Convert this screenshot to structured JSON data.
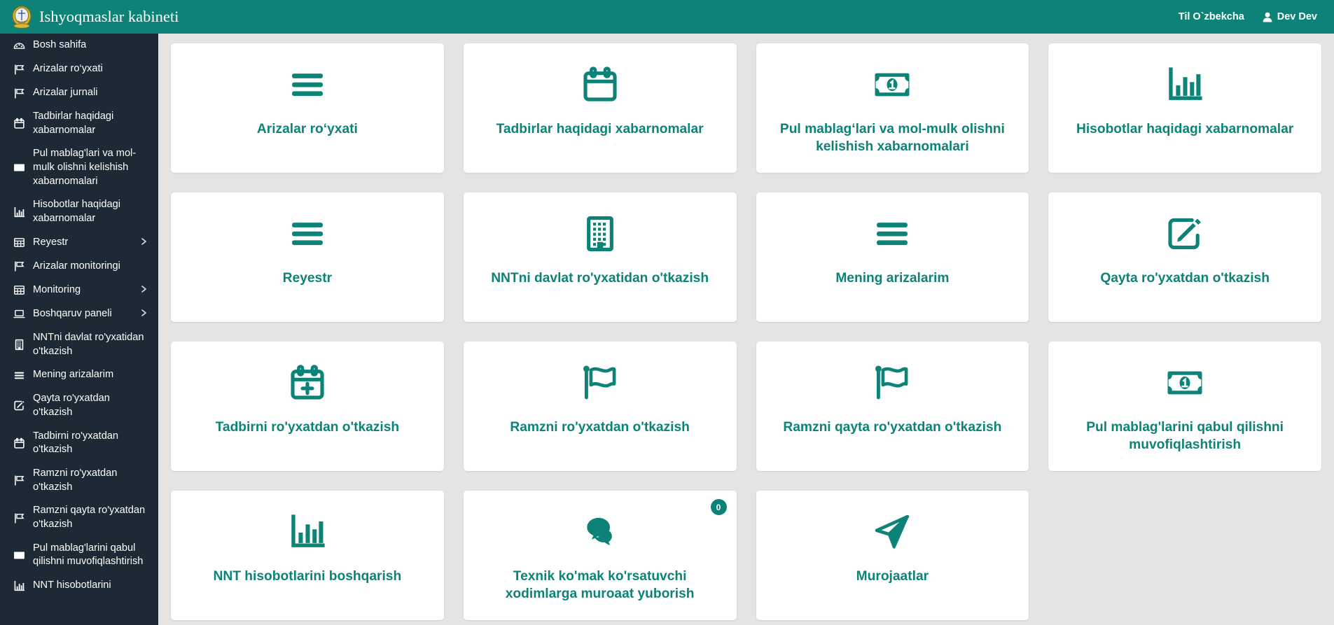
{
  "header": {
    "brand_title": "Ishyoqmaslar kabineti",
    "emblem_icon": "state-emblem-icon",
    "language_label": "Til O`zbekcha",
    "user_name": "Dev Dev",
    "user_icon": "user-icon",
    "background_color": "#0d8377"
  },
  "sidebar": {
    "background_color": "#1d2935",
    "items": [
      {
        "label": "Bosh sahifa",
        "icon": "dashboard-icon",
        "has_caret": false
      },
      {
        "label": "Arizalar ro‘yxati",
        "icon": "flag-icon",
        "has_caret": false
      },
      {
        "label": "Arizalar jurnali",
        "icon": "flag-icon",
        "has_caret": false
      },
      {
        "label": "Tadbirlar haqidagi xabarnomalar",
        "icon": "calendar-icon",
        "has_caret": false
      },
      {
        "label": "Pul mablag'lari va mol-mulk olishni kelishish xabarnomalari",
        "icon": "banknote-icon",
        "has_caret": false
      },
      {
        "label": "Hisobotlar haqidagi xabarnomalar",
        "icon": "bar-chart-icon",
        "has_caret": false
      },
      {
        "label": "Reyestr",
        "icon": "table-icon",
        "has_caret": true
      },
      {
        "label": "Arizalar monitoringi",
        "icon": "flag-icon",
        "has_caret": false
      },
      {
        "label": "Monitoring",
        "icon": "table-icon",
        "has_caret": true
      },
      {
        "label": "Boshqaruv paneli",
        "icon": "laptop-icon",
        "has_caret": true
      },
      {
        "label": "NNTni davlat ro'yxatidan o'tkazish",
        "icon": "building-icon",
        "has_caret": false
      },
      {
        "label": "Mening arizalarim",
        "icon": "list-icon",
        "has_caret": false
      },
      {
        "label": "Qayta ro'yxatdan o'tkazish",
        "icon": "edit-square-icon",
        "has_caret": false
      },
      {
        "label": "Tadbirni ro'yxatdan o'tkazish",
        "icon": "calendar-icon",
        "has_caret": false
      },
      {
        "label": "Ramzni ro'yxatdan o'tkazish",
        "icon": "flag-icon",
        "has_caret": false
      },
      {
        "label": "Ramzni qayta ro'yxatdan o'tkazish",
        "icon": "flag-icon",
        "has_caret": false
      },
      {
        "label": "Pul mablag'larini qabul qilishni muvofiqlashtirish",
        "icon": "banknote-icon",
        "has_caret": false
      },
      {
        "label": "NNT hisobotlarini",
        "icon": "bar-chart-icon",
        "has_caret": false
      }
    ]
  },
  "main": {
    "accent_color": "#0d8377",
    "background_color": "#e4e4e4",
    "cards": [
      {
        "label": "Arizalar ro‘yxati",
        "icon": "hamburger-list-icon"
      },
      {
        "label": "Tadbirlar haqidagi xabarnomalar",
        "icon": "calendar-icon"
      },
      {
        "label": "Pul mablag‘lari va mol-mulk olishni kelishish xabarnomalari",
        "icon": "banknote-icon"
      },
      {
        "label": "Hisobotlar haqidagi xabarnomalar",
        "icon": "bar-chart-icon"
      },
      {
        "label": "Reyestr",
        "icon": "hamburger-list-icon"
      },
      {
        "label": "NNTni davlat ro'yxatidan o'tkazish",
        "icon": "building-icon"
      },
      {
        "label": "Mening arizalarim",
        "icon": "hamburger-list-icon"
      },
      {
        "label": "Qayta ro'yxatdan o'tkazish",
        "icon": "edit-square-icon"
      },
      {
        "label": "Tadbirni ro'yxatdan o'tkazish",
        "icon": "calendar-plus-icon"
      },
      {
        "label": "Ramzni ro'yxatdan o'tkazish",
        "icon": "wavy-flag-icon"
      },
      {
        "label": "Ramzni qayta ro'yxatdan o'tkazish",
        "icon": "wavy-flag-icon"
      },
      {
        "label": "Pul mablag'larini qabul qilishni muvofiqlashtirish",
        "icon": "banknote-icon"
      },
      {
        "label": "NNT hisobotlarini boshqarish",
        "icon": "bar-chart-icon"
      },
      {
        "label": "Texnik ko'mak ko'rsatuvchi xodimlarga muroaat yuborish",
        "icon": "chat-bubbles-icon",
        "badge": "0"
      },
      {
        "label": "Murojaatlar",
        "icon": "paper-plane-icon"
      }
    ]
  }
}
